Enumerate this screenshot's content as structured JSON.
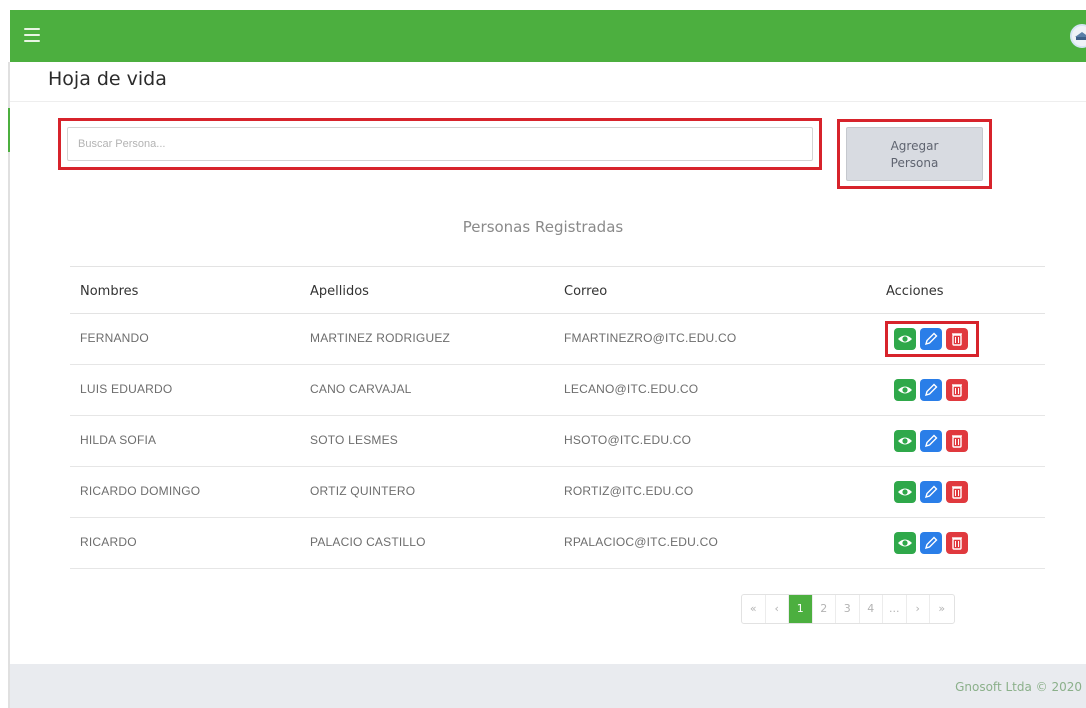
{
  "topbar": {
    "menu_icon": "hamburger-menu-icon",
    "avatar_icon": "user-avatar-icon",
    "color": "#4caf3f"
  },
  "page": {
    "title": "Hoja de vida"
  },
  "search": {
    "placeholder": "Buscar Persona...",
    "value": ""
  },
  "add_button": {
    "line1": "Agregar",
    "line2": "Persona"
  },
  "section_title": "Personas Registradas",
  "table": {
    "headers": [
      "Nombres",
      "Apellidos",
      "Correo",
      "Acciones"
    ],
    "rows": [
      [
        "FERNANDO",
        "MARTINEZ RODRIGUEZ",
        "FMARTINEZRO@ITC.EDU.CO"
      ],
      [
        "LUIS EDUARDO",
        "CANO CARVAJAL",
        "LECANO@ITC.EDU.CO"
      ],
      [
        "HILDA SOFIA",
        "SOTO LESMES",
        "HSOTO@ITC.EDU.CO"
      ],
      [
        "RICARDO DOMINGO",
        "ORTIZ QUINTERO",
        "RORTIZ@ITC.EDU.CO"
      ],
      [
        "RICARDO",
        "PALACIO CASTILLO",
        "RPALACIOC@ITC.EDU.CO"
      ]
    ],
    "action_icons": [
      "eye-icon",
      "pencil-icon",
      "trash-icon"
    ],
    "action_colors": [
      "#2fa84a",
      "#2a7ee8",
      "#e0393e"
    ]
  },
  "pagination": {
    "items": [
      "«",
      "‹",
      "1",
      "2",
      "3",
      "4",
      "...",
      "›",
      "»"
    ],
    "active": "1"
  },
  "footer": {
    "text": "Gnosoft Ltda © 2020"
  }
}
